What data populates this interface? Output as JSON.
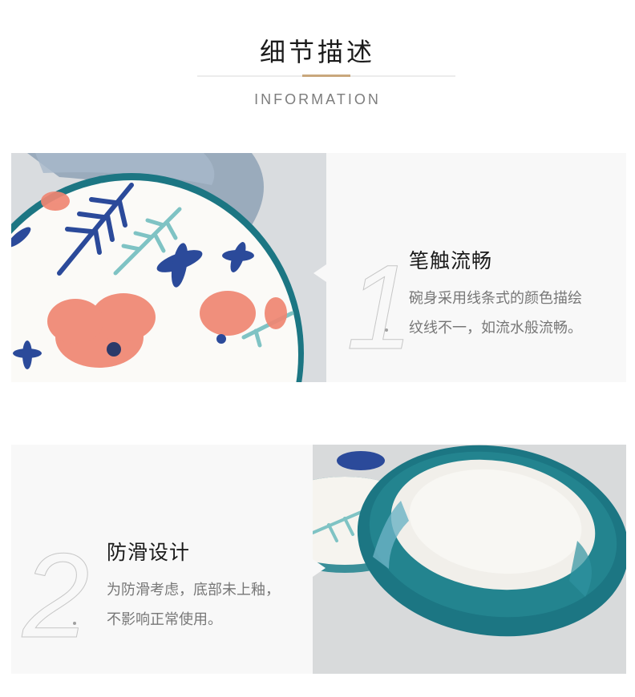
{
  "header": {
    "title": "细节描述",
    "subtitle": "INFORMATION"
  },
  "features": [
    {
      "number": "1",
      "title": "笔触流畅",
      "desc_line1": "碗身采用线条式的颜色描绘",
      "desc_line2": "纹线不一，如流水般流畅。"
    },
    {
      "number": "2",
      "title": "防滑设计",
      "desc_line1": "为防滑考虑，底部未上釉，",
      "desc_line2": "不影响正常使用。"
    }
  ],
  "colors": {
    "accent_line": "#c9a77c",
    "panel_bg": "#f8f8f8",
    "glaze_teal": "#1d7b86",
    "flower_pink": "#f08672",
    "flower_blue": "#2b4a9a",
    "leaf_teal": "#7fc3c4"
  }
}
